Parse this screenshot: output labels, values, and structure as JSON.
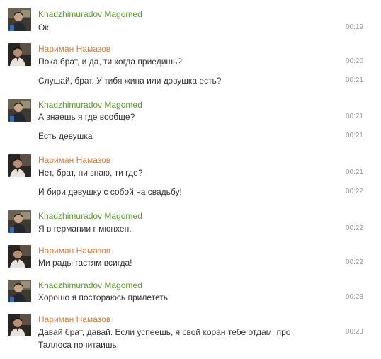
{
  "chat": {
    "colors": {
      "sender_green": "#5aa02c",
      "sender_orange": "#e07b39",
      "message_text": "#333333",
      "timestamp": "#9a9a9a"
    },
    "groups": [
      {
        "sender": "Khadzhimuradov Magomed",
        "sender_color": "green",
        "avatar_icon": "user-avatar-photo",
        "messages": [
          {
            "text": "Ок",
            "time": "00:19"
          }
        ]
      },
      {
        "sender": "Нариман Намазов",
        "sender_color": "orange",
        "avatar_icon": "user-avatar-photo",
        "messages": [
          {
            "text": "Пока брат, и да, ти когда приедишь?",
            "time": "00:20"
          },
          {
            "text": "Слушай, брат. У тибя жина или дэвушка есть?",
            "time": "00:21"
          }
        ]
      },
      {
        "sender": "Khadzhimuradov Magomed",
        "sender_color": "green",
        "avatar_icon": "user-avatar-photo",
        "messages": [
          {
            "text": "А знаешь я где вообще?",
            "time": "00:21"
          },
          {
            "text": "Есть девушка",
            "time": "00:21"
          }
        ]
      },
      {
        "sender": "Нариман Намазов",
        "sender_color": "orange",
        "avatar_icon": "user-avatar-photo",
        "messages": [
          {
            "text": "Нет, брат, ни знаю, ти где?",
            "time": "00:21"
          },
          {
            "text": "И бири девушку с собой на свадьбу!",
            "time": "00:22"
          }
        ]
      },
      {
        "sender": "Khadzhimuradov Magomed",
        "sender_color": "green",
        "avatar_icon": "user-avatar-photo",
        "messages": [
          {
            "text": "Я в германии г мюнхен.",
            "time": "00:22"
          }
        ]
      },
      {
        "sender": "Нариман Намазов",
        "sender_color": "orange",
        "avatar_icon": "user-avatar-photo",
        "messages": [
          {
            "text": "Ми рады гастям всигда!",
            "time": "00:22"
          }
        ]
      },
      {
        "sender": "Khadzhimuradov Magomed",
        "sender_color": "green",
        "avatar_icon": "user-avatar-photo",
        "messages": [
          {
            "text": "Хорошо я постораюсь прилететь.",
            "time": "00:23"
          }
        ]
      },
      {
        "sender": "Нариман Намазов",
        "sender_color": "orange",
        "avatar_icon": "user-avatar-photo",
        "messages": [
          {
            "text": "Давай брат, давай. Если успеешь, я свой коран тебе отдам, про Таллоса почитаишь.",
            "time": "00:23"
          }
        ]
      }
    ]
  }
}
